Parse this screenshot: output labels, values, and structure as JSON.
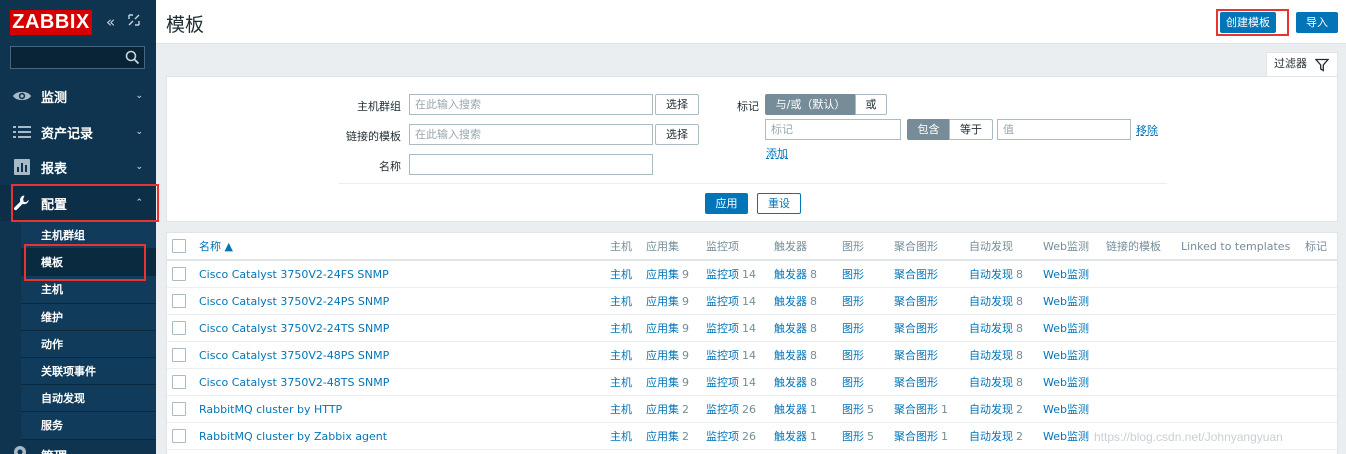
{
  "app": {
    "logo": "ZABBIX",
    "page_title": "模板",
    "watermark": "https://blog.csdn.net/Johnyangyuan"
  },
  "colors": {
    "sidebar_bg": "#0e3450",
    "accent": "#0275b8",
    "logo_red": "#d40000",
    "highlight_box": "#e8332e"
  },
  "sidebar": {
    "collapse_icon": "double-chevron-left-icon",
    "kiosk_icon": "kiosk-mode-icon",
    "search_icon": "search-icon",
    "menu": [
      {
        "label": "监测",
        "icon": "eye-icon"
      },
      {
        "label": "资产记录",
        "icon": "list-icon"
      },
      {
        "label": "报表",
        "icon": "bar-chart-icon"
      },
      {
        "label": "配置",
        "icon": "wrench-icon"
      }
    ],
    "submenu": [
      "主机群组",
      "模板",
      "主机",
      "维护",
      "动作",
      "关联项事件",
      "自动发现",
      "服务"
    ],
    "admin_label": "管理"
  },
  "header": {
    "create_button": "创建模板",
    "import_button": "导入"
  },
  "filter": {
    "tab_label": "过滤器",
    "host_groups_label": "主机群组",
    "host_groups_placeholder": "在此输入搜索",
    "linked_templates_label": "链接的模板",
    "linked_templates_placeholder": "在此输入搜索",
    "name_label": "名称",
    "name_value": "",
    "select_label": "选择",
    "tags_label": "标记",
    "and_or_label": "与/或（默认）",
    "or_label": "或",
    "tag_placeholder": "标记",
    "contains_label": "包含",
    "equals_label": "等于",
    "value_placeholder": "值",
    "remove_label": "移除",
    "add_label": "添加",
    "apply_label": "应用",
    "reset_label": "重设"
  },
  "table": {
    "columns": [
      "名称 ▲",
      "主机",
      "应用集",
      "监控项",
      "触发器",
      "图形",
      "聚合图形",
      "自动发现",
      "Web监测",
      "链接的模板",
      "Linked to templates",
      "标记"
    ],
    "rows": [
      {
        "name": "Cisco Catalyst 3750V2-24FS SNMP",
        "hosts": "主机",
        "apps": "应用集",
        "apps_n": "9",
        "items": "监控项",
        "items_n": "14",
        "triggers": "触发器",
        "triggers_n": "8",
        "graphs": "图形",
        "graphs_n": "",
        "screens": "聚合图形",
        "screens_n": "",
        "discovery": "自动发现",
        "discovery_n": "8",
        "web": "Web监测"
      },
      {
        "name": "Cisco Catalyst 3750V2-24PS SNMP",
        "hosts": "主机",
        "apps": "应用集",
        "apps_n": "9",
        "items": "监控项",
        "items_n": "14",
        "triggers": "触发器",
        "triggers_n": "8",
        "graphs": "图形",
        "graphs_n": "",
        "screens": "聚合图形",
        "screens_n": "",
        "discovery": "自动发现",
        "discovery_n": "8",
        "web": "Web监测"
      },
      {
        "name": "Cisco Catalyst 3750V2-24TS SNMP",
        "hosts": "主机",
        "apps": "应用集",
        "apps_n": "9",
        "items": "监控项",
        "items_n": "14",
        "triggers": "触发器",
        "triggers_n": "8",
        "graphs": "图形",
        "graphs_n": "",
        "screens": "聚合图形",
        "screens_n": "",
        "discovery": "自动发现",
        "discovery_n": "8",
        "web": "Web监测"
      },
      {
        "name": "Cisco Catalyst 3750V2-48PS SNMP",
        "hosts": "主机",
        "apps": "应用集",
        "apps_n": "9",
        "items": "监控项",
        "items_n": "14",
        "triggers": "触发器",
        "triggers_n": "8",
        "graphs": "图形",
        "graphs_n": "",
        "screens": "聚合图形",
        "screens_n": "",
        "discovery": "自动发现",
        "discovery_n": "8",
        "web": "Web监测"
      },
      {
        "name": "Cisco Catalyst 3750V2-48TS SNMP",
        "hosts": "主机",
        "apps": "应用集",
        "apps_n": "9",
        "items": "监控项",
        "items_n": "14",
        "triggers": "触发器",
        "triggers_n": "8",
        "graphs": "图形",
        "graphs_n": "",
        "screens": "聚合图形",
        "screens_n": "",
        "discovery": "自动发现",
        "discovery_n": "8",
        "web": "Web监测"
      },
      {
        "name": "RabbitMQ cluster by HTTP",
        "hosts": "主机",
        "apps": "应用集",
        "apps_n": "2",
        "items": "监控项",
        "items_n": "26",
        "triggers": "触发器",
        "triggers_n": "1",
        "graphs": "图形",
        "graphs_n": "5",
        "screens": "聚合图形",
        "screens_n": "1",
        "discovery": "自动发现",
        "discovery_n": "2",
        "web": "Web监测"
      },
      {
        "name": "RabbitMQ cluster by Zabbix agent",
        "hosts": "主机",
        "apps": "应用集",
        "apps_n": "2",
        "items": "监控项",
        "items_n": "26",
        "triggers": "触发器",
        "triggers_n": "1",
        "graphs": "图形",
        "graphs_n": "5",
        "screens": "聚合图形",
        "screens_n": "1",
        "discovery": "自动发现",
        "discovery_n": "2",
        "web": "Web监测"
      }
    ]
  }
}
